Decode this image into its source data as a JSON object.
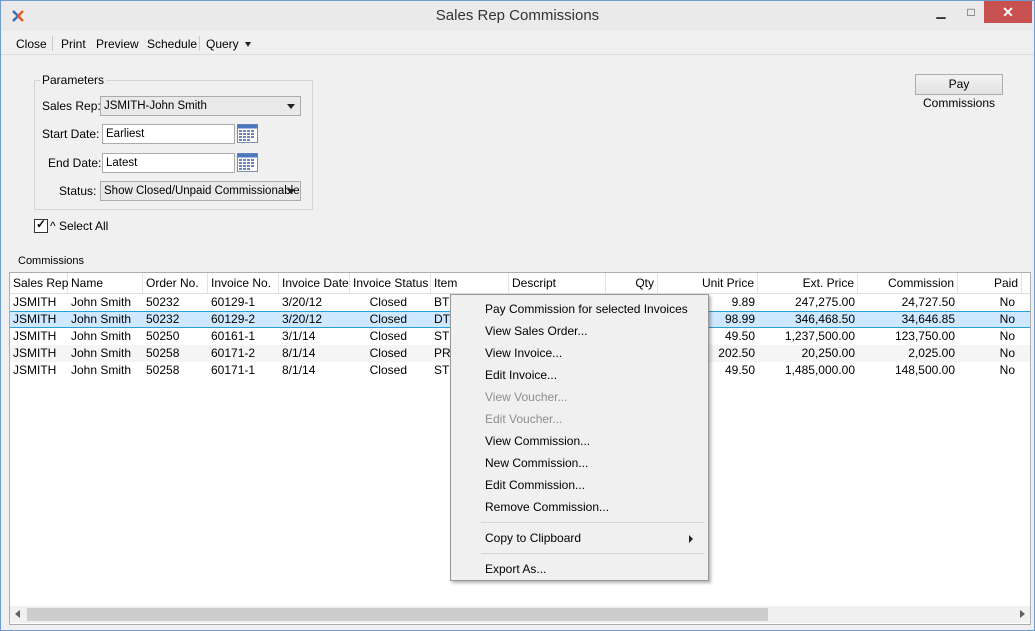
{
  "window": {
    "title": "Sales Rep Commissions",
    "min_glyph": "▁",
    "max_glyph": "□",
    "close_glyph": "✕"
  },
  "menu": {
    "close": "Close",
    "print": "Print",
    "preview": "Preview",
    "schedule": "Schedule",
    "query": "Query"
  },
  "parameters": {
    "legend": "Parameters",
    "sales_rep_label": "Sales Rep:",
    "sales_rep_value": "JSMITH-John Smith",
    "start_date_label": "Start Date:",
    "start_date_value": "Earliest",
    "end_date_label": "End Date:",
    "end_date_value": "Latest",
    "status_label": "Status:",
    "status_value": "Show Closed/Unpaid Commissionable"
  },
  "select_all": {
    "label": "^ Select All",
    "checked": true
  },
  "pay_commissions_button": "Pay Commissions",
  "commissions_label": "Commissions",
  "table": {
    "columns": [
      "Sales Rep",
      "Name",
      "Order No.",
      "Invoice No.",
      "Invoice Date",
      "Invoice Status",
      "Item",
      "Descript",
      "Qty",
      "Unit Price",
      "Ext. Price",
      "Commission",
      "Paid"
    ],
    "rows": [
      [
        "JSMITH",
        "John Smith",
        "50232",
        "60129-1",
        "3/20/12",
        "Closed",
        "BTR",
        "",
        "",
        "9.89",
        "247,275.00",
        "24,727.50",
        "No"
      ],
      [
        "JSMITH",
        "John Smith",
        "50232",
        "60129-2",
        "3/20/12",
        "Closed",
        "DTD",
        "",
        "",
        "98.99",
        "346,468.50",
        "34,646.85",
        "No"
      ],
      [
        "JSMITH",
        "John Smith",
        "50250",
        "60161-1",
        "3/1/14",
        "Closed",
        "STC",
        "",
        "",
        "49.50",
        "1,237,500.00",
        "123,750.00",
        "No"
      ],
      [
        "JSMITH",
        "John Smith",
        "50258",
        "60171-2",
        "8/1/14",
        "Closed",
        "PRO",
        "",
        "",
        "202.50",
        "20,250.00",
        "2,025.00",
        "No"
      ],
      [
        "JSMITH",
        "John Smith",
        "50258",
        "60171-1",
        "8/1/14",
        "Closed",
        "STC",
        "",
        "",
        "49.50",
        "1,485,000.00",
        "148,500.00",
        "No"
      ]
    ],
    "selected_row": 1
  },
  "context_menu": {
    "items": [
      {
        "label": "Pay Commission for selected Invoices",
        "enabled": true
      },
      {
        "label": "View Sales Order...",
        "enabled": true
      },
      {
        "label": "View Invoice...",
        "enabled": true
      },
      {
        "label": "Edit Invoice...",
        "enabled": true
      },
      {
        "label": "View Voucher...",
        "enabled": false
      },
      {
        "label": "Edit Voucher...",
        "enabled": false
      },
      {
        "label": "View Commission...",
        "enabled": true
      },
      {
        "label": "New Commission...",
        "enabled": true
      },
      {
        "label": "Edit Commission...",
        "enabled": true
      },
      {
        "label": "Remove Commission...",
        "enabled": true
      },
      {
        "label": "Copy to Clipboard",
        "enabled": true
      },
      {
        "label": "Export As...",
        "enabled": true
      }
    ]
  },
  "colors": {
    "selected_row": "#cde8ff",
    "close_button": "#c75050",
    "window_border": "#6f9bd1"
  }
}
